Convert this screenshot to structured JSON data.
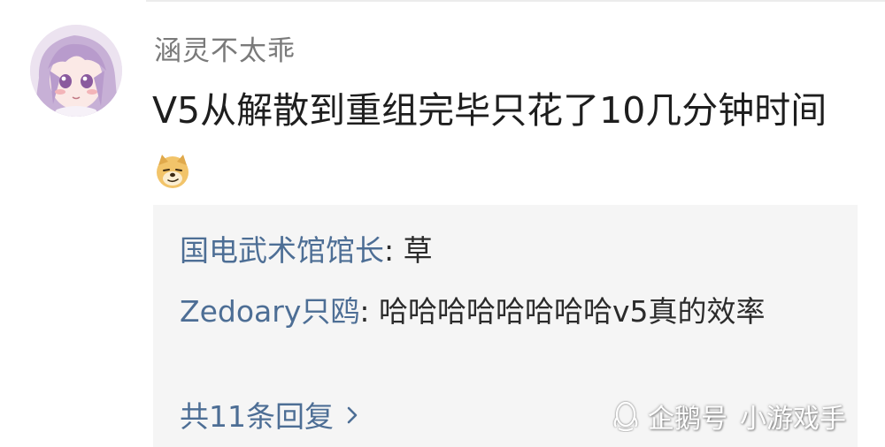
{
  "comment": {
    "username": "涵灵不太乖",
    "text": "V5从解散到重组完毕只花了10几分钟时间",
    "emoji": "doge-emoji"
  },
  "replies": [
    {
      "author": "国电武术馆馆长",
      "separator": ": ",
      "text": "草"
    },
    {
      "author": "Zedoary只鸥",
      "separator": ": ",
      "text": "哈哈哈哈哈哈哈哈v5真的效率"
    }
  ],
  "more_replies": {
    "label": "共11条回复",
    "icon": "chevron-right-icon"
  },
  "watermark": {
    "icon": "penguin-logo-icon",
    "source": "企鹅号",
    "account": "小游戏手"
  },
  "colors": {
    "username": "#7a7a7a",
    "link": "#4d6e95",
    "reply_background": "#f5f5f5",
    "text": "#1e1e1e"
  }
}
